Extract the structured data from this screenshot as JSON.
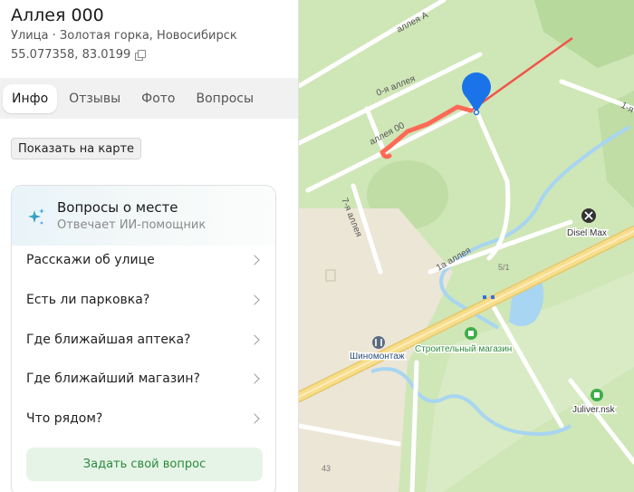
{
  "place": {
    "title": "Аллея 000",
    "subtitle": "Улица · Золотая горка, Новосибирск",
    "coordinates": "55.077358, 83.0199"
  },
  "tabs": [
    {
      "label": "Инфо",
      "active": true
    },
    {
      "label": "Отзывы",
      "active": false
    },
    {
      "label": "Фото",
      "active": false
    },
    {
      "label": "Вопросы",
      "active": false
    }
  ],
  "show_on_map_label": "Показать на карте",
  "ai_card": {
    "title": "Вопросы о месте",
    "subtitle": "Отвечает ИИ-помощник",
    "questions": [
      "Расскажи об улице",
      "Есть ли парковка?",
      "Где ближайшая аптека?",
      "Где ближайший магазин?",
      "Что рядом?"
    ],
    "ask_button_label": "Задать свой вопрос"
  },
  "map": {
    "street_labels": [
      "аллея А",
      "0-я аллея",
      "аллея 00",
      "7-я аллея",
      "1а аллея",
      "1-я"
    ],
    "pois": [
      "Disel Max",
      "Строительный магазин",
      "Шиномонтаж",
      "Juliver.nsk"
    ],
    "house_numbers": [
      "5/1",
      "43"
    ],
    "colors": {
      "route": "#f0554a",
      "route_highlight": "#ff6a57",
      "pin": "#1a73e8",
      "green_area": "#cfe6b7",
      "built_area": "#ece6d6",
      "water": "#a7d5f2",
      "main_road": "#f7dd8c",
      "poi_green": "#3fae4a"
    }
  }
}
